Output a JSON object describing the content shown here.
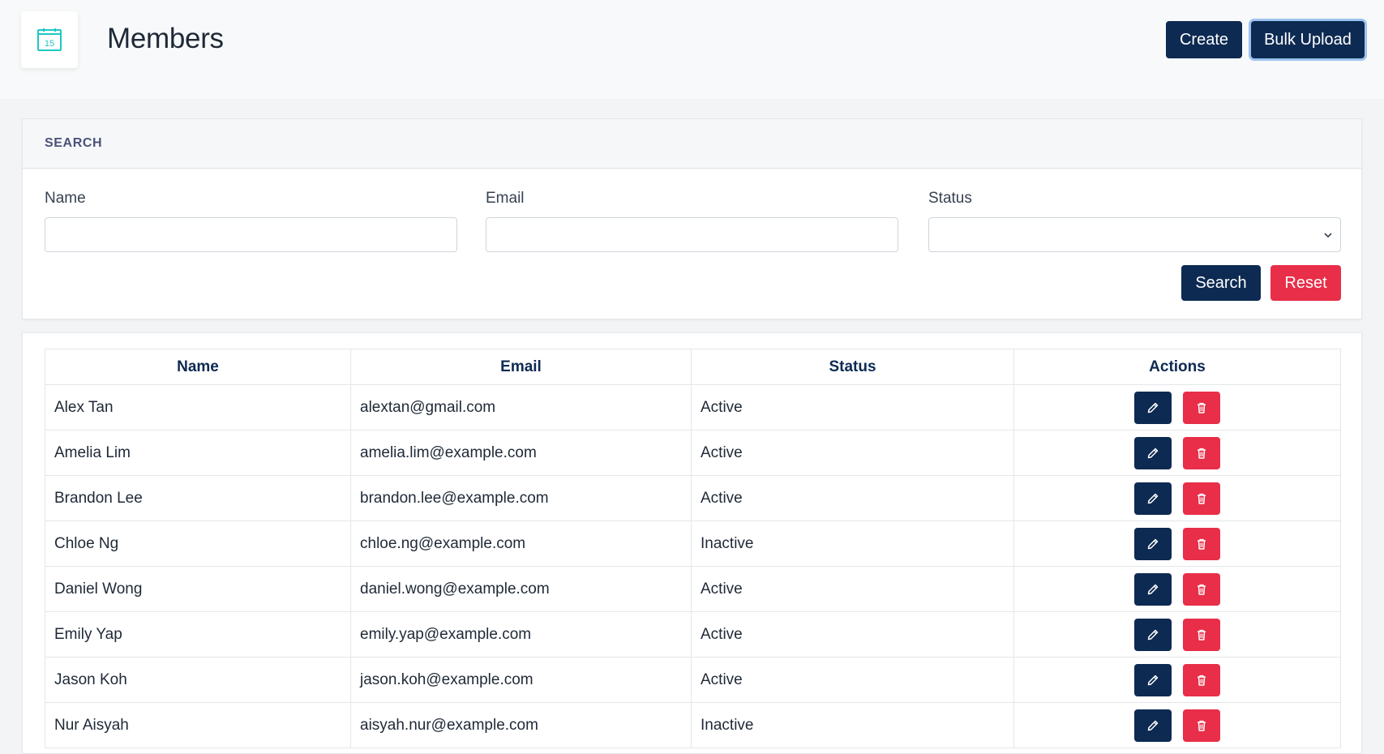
{
  "header": {
    "logo_day": "15",
    "title": "Members",
    "create_label": "Create",
    "bulk_upload_label": "Bulk Upload"
  },
  "search": {
    "section_title": "SEARCH",
    "name_label": "Name",
    "email_label": "Email",
    "status_label": "Status",
    "name_value": "",
    "email_value": "",
    "status_value": "",
    "search_label": "Search",
    "reset_label": "Reset"
  },
  "table": {
    "columns": [
      "Name",
      "Email",
      "Status",
      "Actions"
    ],
    "rows": [
      {
        "name": "Alex Tan",
        "email": "alextan@gmail.com",
        "status": "Active"
      },
      {
        "name": "Amelia Lim",
        "email": "amelia.lim@example.com",
        "status": "Active"
      },
      {
        "name": "Brandon Lee",
        "email": "brandon.lee@example.com",
        "status": "Active"
      },
      {
        "name": "Chloe Ng",
        "email": "chloe.ng@example.com",
        "status": "Inactive"
      },
      {
        "name": "Daniel Wong",
        "email": "daniel.wong@example.com",
        "status": "Active"
      },
      {
        "name": "Emily Yap",
        "email": "emily.yap@example.com",
        "status": "Active"
      },
      {
        "name": "Jason Koh",
        "email": "jason.koh@example.com",
        "status": "Active"
      },
      {
        "name": "Nur Aisyah",
        "email": "aisyah.nur@example.com",
        "status": "Inactive"
      }
    ]
  },
  "icons": {
    "logo": "calendar-icon",
    "edit": "pencil-icon",
    "delete": "trash-icon",
    "select": "chevron-down-icon"
  },
  "colors": {
    "primary": "#0d2a52",
    "danger": "#e82e48",
    "logo_accent": "#1fc7c2",
    "section_title": "#4b527a"
  }
}
